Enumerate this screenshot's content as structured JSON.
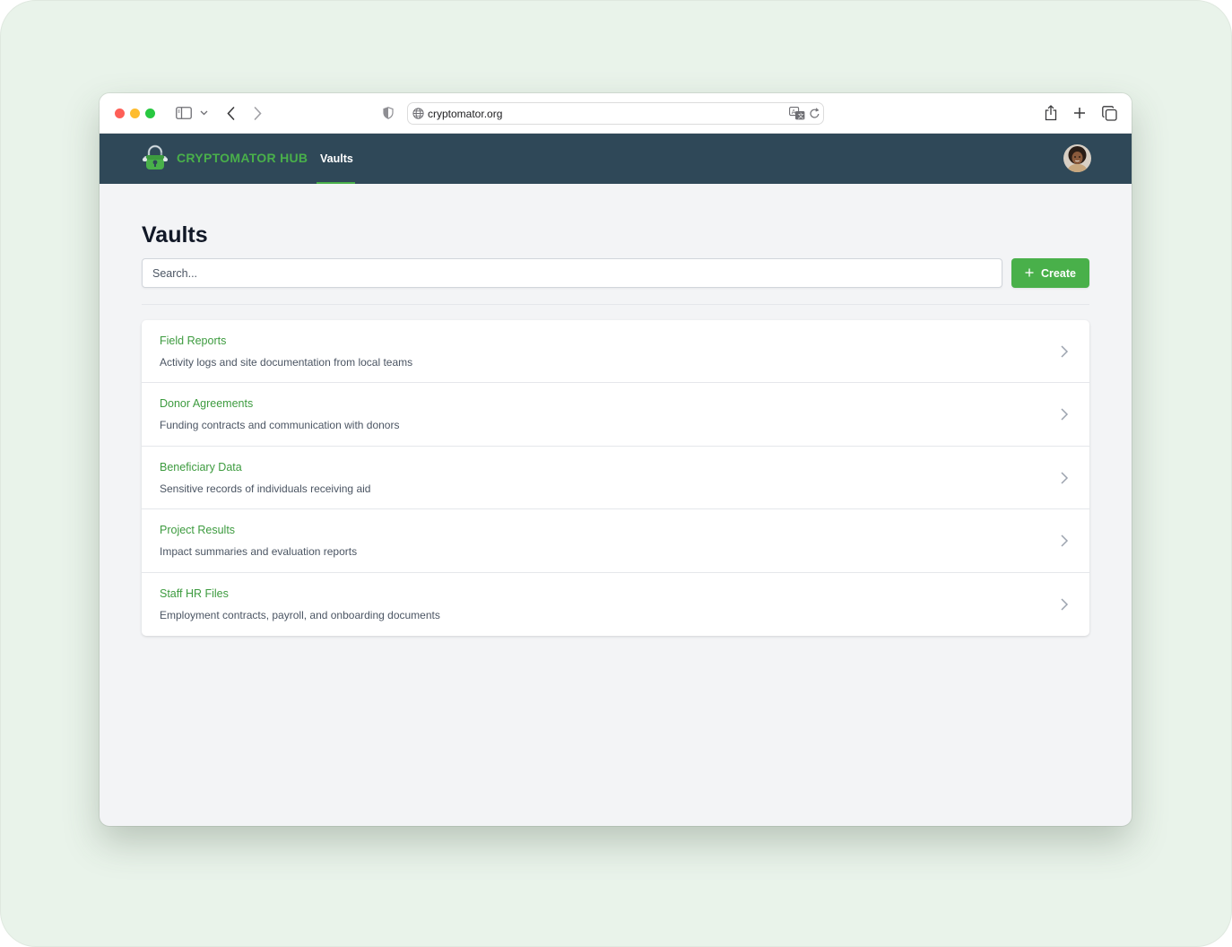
{
  "browser": {
    "url": "cryptomator.org"
  },
  "header": {
    "brand": "CRYPTOMATOR HUB",
    "nav": [
      {
        "label": "Vaults",
        "active": true
      }
    ],
    "accent_color": "#49b04a",
    "bar_color": "#2f4858"
  },
  "main": {
    "title": "Vaults",
    "search_placeholder": "Search...",
    "create_label": "Create",
    "vaults": [
      {
        "name": "Field Reports",
        "description": "Activity logs and site documentation from local teams"
      },
      {
        "name": "Donor Agreements",
        "description": "Funding contracts and communication with donors"
      },
      {
        "name": "Beneficiary Data",
        "description": "Sensitive records of individuals receiving aid"
      },
      {
        "name": "Project Results",
        "description": "Impact summaries and evaluation reports"
      },
      {
        "name": "Staff HR Files",
        "description": "Employment contracts, payroll, and onboarding documents"
      }
    ]
  }
}
